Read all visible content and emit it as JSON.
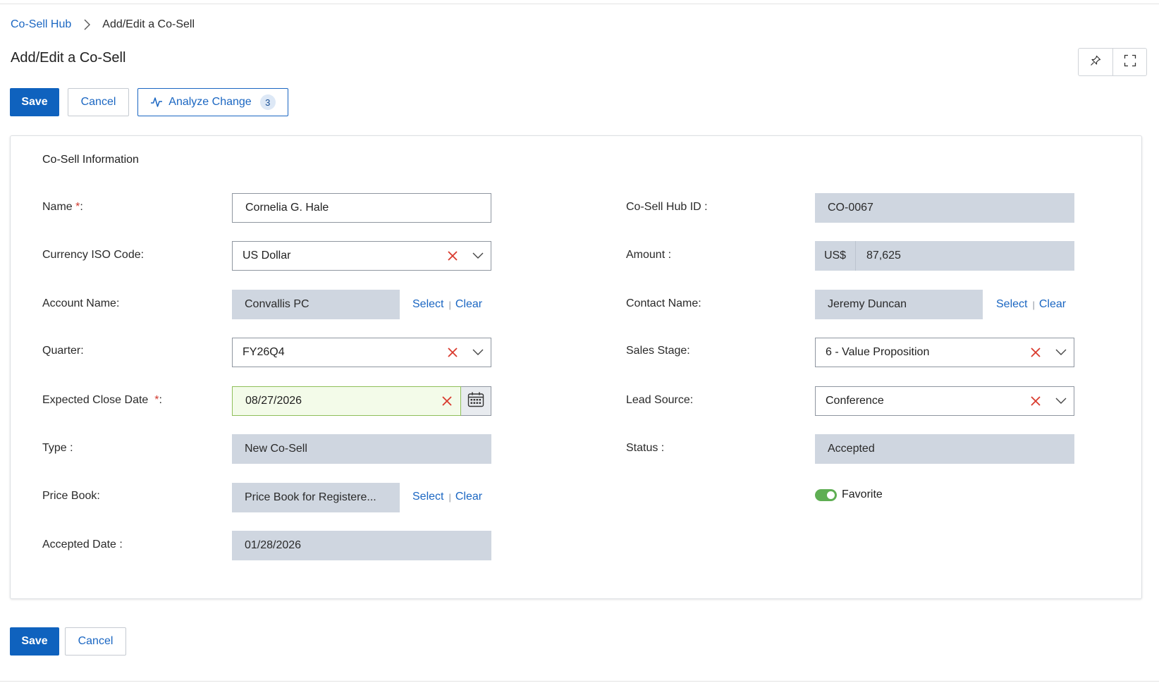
{
  "breadcrumb": {
    "parent": "Co-Sell Hub",
    "current": "Add/Edit a Co-Sell"
  },
  "page": {
    "title": "Add/Edit a Co-Sell"
  },
  "toolbar": {
    "save_label": "Save",
    "cancel_label": "Cancel",
    "analyze_label": "Analyze Change",
    "analyze_count": "3"
  },
  "view_controls": {
    "pin_icon": "pin-icon",
    "fullscreen_icon": "fullscreen-icon"
  },
  "section": {
    "title": "Co-Sell Information"
  },
  "fields": {
    "name": {
      "label": "Name",
      "required_mark": "*",
      "label_suffix": ":",
      "value": "Cornelia G. Hale"
    },
    "currency": {
      "label": "Currency ISO Code:",
      "value": "US Dollar"
    },
    "account": {
      "label": "Account Name:",
      "value": "Convallis PC",
      "select": "Select",
      "clear": "Clear"
    },
    "quarter": {
      "label": "Quarter:",
      "value": "FY26Q4"
    },
    "close_date": {
      "label": "Expected Close Date",
      "required_mark": "*",
      "label_suffix": ":",
      "value": "08/27/2026"
    },
    "type": {
      "label": "Type :",
      "value": "New Co-Sell"
    },
    "price_book": {
      "label": "Price Book:",
      "value": "Price Book for Registere...",
      "select": "Select",
      "clear": "Clear"
    },
    "accepted_date": {
      "label": "Accepted Date :",
      "value": "01/28/2026"
    },
    "hub_id": {
      "label": "Co-Sell Hub ID :",
      "value": "CO-0067"
    },
    "amount": {
      "label": "Amount :",
      "currency": "US$",
      "value": "87,625"
    },
    "contact": {
      "label": "Contact Name:",
      "value": "Jeremy Duncan",
      "select": "Select",
      "clear": "Clear"
    },
    "sales_stage": {
      "label": "Sales Stage:",
      "value": "6 - Value Proposition"
    },
    "lead_source": {
      "label": "Lead Source:",
      "value": "Conference"
    },
    "status": {
      "label": "Status :",
      "value": "Accepted"
    },
    "favorite": {
      "label": "Favorite",
      "on": true
    }
  },
  "footer": {
    "save_label": "Save",
    "cancel_label": "Cancel"
  },
  "colors": {
    "primary": "#0f62be",
    "link": "#1a66c2",
    "readonly_bg": "#cfd6e0",
    "clear_x": "#d93a2e",
    "toggle_on": "#5fae53"
  }
}
